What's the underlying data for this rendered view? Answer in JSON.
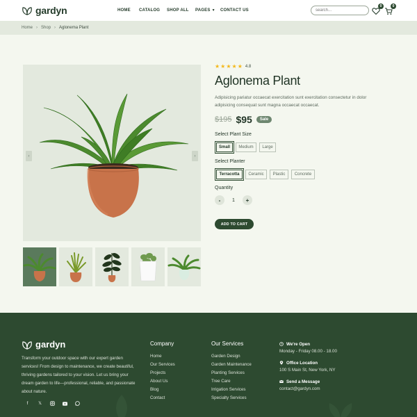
{
  "brand": {
    "name": "gardyn"
  },
  "nav": {
    "items": [
      {
        "label": "HOME"
      },
      {
        "label": "CATALOG"
      },
      {
        "label": "SHOP ALL"
      },
      {
        "label": "PAGES"
      },
      {
        "label": "CONTACT US"
      }
    ]
  },
  "search": {
    "placeholder": "search..."
  },
  "wishlist": {
    "count": "0"
  },
  "cart": {
    "count": "0"
  },
  "breadcrumb": {
    "home": "Home",
    "shop": "Shop",
    "current": "Aglonema Plant"
  },
  "product": {
    "rating": "4.8",
    "title": "Aglonema Plant",
    "description": "Adipisicing pariatur occaecat exercitation sunt exercitation consectetur in dolor adipisicing consequat sunt magna occaecat occaecat.",
    "old_price": "$195",
    "price": "$95",
    "sale_label": "Sale",
    "size_label": "Select Plant Size",
    "sizes": [
      "Small",
      "Medium",
      "Large"
    ],
    "selected_size": "Small",
    "planter_label": "Select Planter",
    "planters": [
      "Terracotta",
      "Ceramic",
      "Plastic",
      "Concrete"
    ],
    "selected_planter": "Terracotta",
    "quantity_label": "Quantity",
    "quantity": "1",
    "add_to_cart": "ADD TO CART"
  },
  "footer": {
    "brand": "gardyn",
    "description": "Transform your outdoor space with our expert garden services! From design to maintenance, we create beautiful, thriving gardens tailored to your vision. Let us bring your dream garden to life—professional, reliable, and passionate about nature.",
    "company": {
      "title": "Company",
      "links": [
        "Home",
        "Our Services",
        "Projects",
        "About Us",
        "Blog",
        "Contact"
      ]
    },
    "services": {
      "title": "Our Services",
      "links": [
        "Garden Design",
        "Garden Maintenance",
        "Planting Services",
        "Tree Care",
        "Irrigation Services",
        "Specialty Services"
      ]
    },
    "contact": {
      "open_label": "We're Open",
      "open_value": "Monday - Friday 08.00 - 18.00",
      "location_label": "Office Location",
      "location_value": "100 S Main St, New York, NY",
      "message_label": "Send a Message",
      "message_value": "contact@gardyn.com"
    },
    "socials": [
      "facebook-icon",
      "x-icon",
      "instagram-icon",
      "youtube-icon",
      "whatsapp-icon"
    ]
  },
  "colors": {
    "primary": "#2d4a30",
    "page_bg": "#f4f7ef",
    "image_bg": "#e3e9de",
    "star": "#f3b81b",
    "sale": "#6e8770"
  }
}
